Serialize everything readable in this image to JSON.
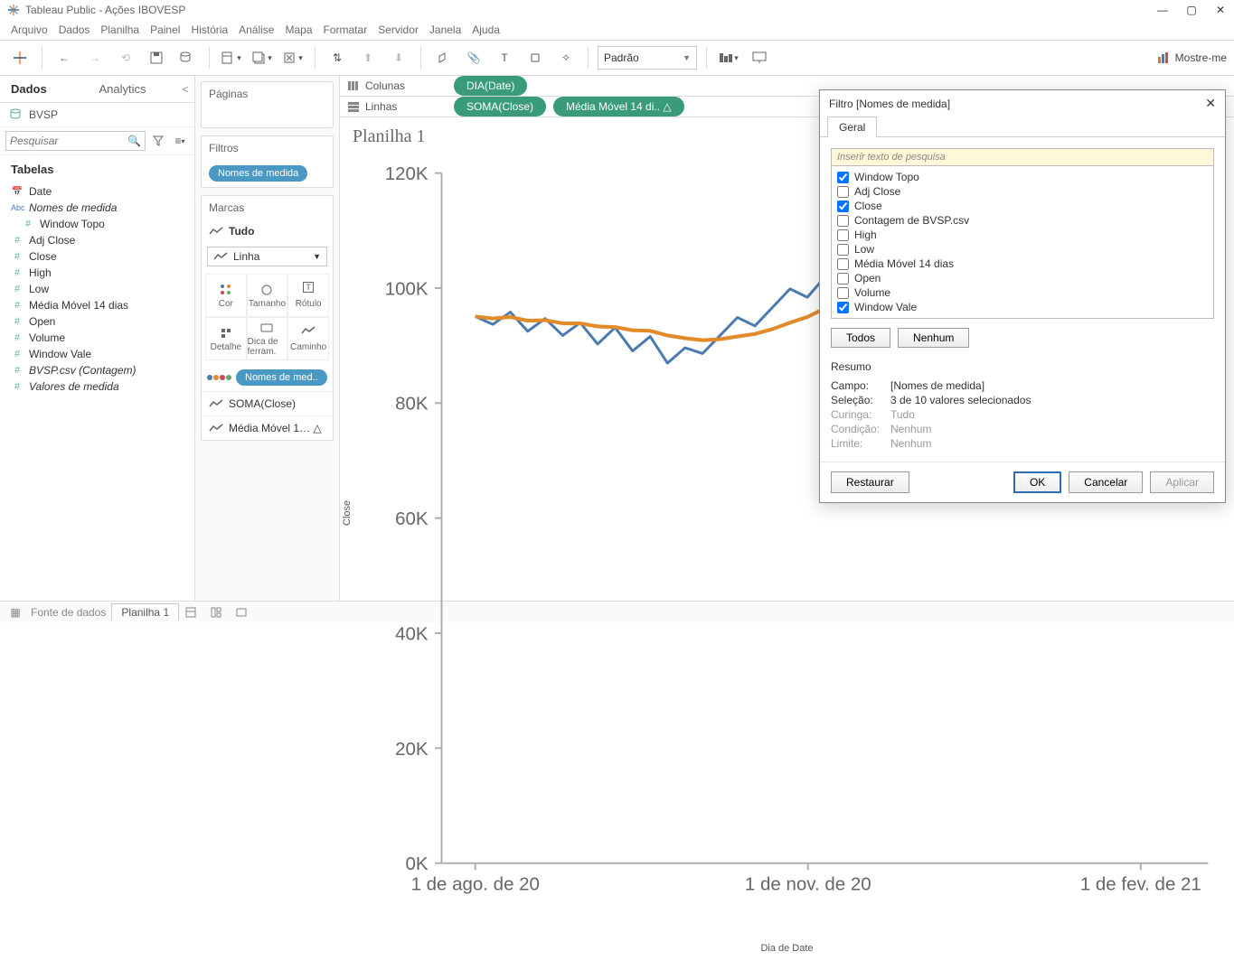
{
  "window": {
    "title": "Tableau Public - Ações IBOVESP"
  },
  "menu": [
    "Arquivo",
    "Dados",
    "Planilha",
    "Painel",
    "História",
    "Análise",
    "Mapa",
    "Formatar",
    "Servidor",
    "Janela",
    "Ajuda"
  ],
  "toolbar": {
    "fit_mode": "Padrão",
    "showme": "Mostre-me"
  },
  "datapane": {
    "tabs": {
      "data": "Dados",
      "analytics": "Analytics"
    },
    "datasource": "BVSP",
    "search_placeholder": "Pesquisar",
    "section": "Tabelas",
    "fields": [
      {
        "icon": "date",
        "label": "Date",
        "italic": false
      },
      {
        "icon": "abc",
        "label": "Nomes de medida",
        "italic": true
      },
      {
        "icon": "num",
        "label": "Window Topo",
        "italic": false,
        "indent": true
      },
      {
        "icon": "num",
        "label": "Adj Close",
        "italic": false
      },
      {
        "icon": "num",
        "label": "Close",
        "italic": false
      },
      {
        "icon": "num",
        "label": "High",
        "italic": false
      },
      {
        "icon": "num",
        "label": "Low",
        "italic": false
      },
      {
        "icon": "num",
        "label": "Média Móvel 14 dias",
        "italic": false
      },
      {
        "icon": "num",
        "label": "Open",
        "italic": false
      },
      {
        "icon": "num",
        "label": "Volume",
        "italic": false
      },
      {
        "icon": "num",
        "label": "Window Vale",
        "italic": false
      },
      {
        "icon": "num",
        "label": "BVSP.csv (Contagem)",
        "italic": true
      },
      {
        "icon": "num",
        "label": "Valores de medida",
        "italic": true
      }
    ]
  },
  "cards": {
    "pages": "Páginas",
    "filters": "Filtros",
    "filters_pill": "Nomes de medida",
    "marks": "Marcas",
    "marks_all": "Tudo",
    "marks_type": "Linha",
    "cells": [
      "Cor",
      "Tamanho",
      "Rótulo",
      "Detalhe",
      "Dica de ferram.",
      "Caminho"
    ],
    "marks_pill": "Nomes de med..",
    "measure_rows": [
      "SOMA(Close)",
      "Média Móvel 1…  △"
    ]
  },
  "shelves": {
    "columns_label": "Colunas",
    "rows_label": "Linhas",
    "columns": [
      "DIA(Date)"
    ],
    "rows": [
      "SOMA(Close)",
      "Média Móvel 14 di..  △"
    ]
  },
  "sheet": {
    "title": "Planilha 1",
    "y_axis": "Close",
    "x_axis": "Dia de Date"
  },
  "chart_data": {
    "type": "line",
    "xlabel": "Dia de Date",
    "ylabel": "Close",
    "ylim": [
      0,
      130000
    ],
    "y_ticks": [
      "0K",
      "20K",
      "40K",
      "60K",
      "80K",
      "100K",
      "120K"
    ],
    "x_ticks": [
      "1 de ago. de 20",
      "1 de nov. de 20",
      "1 de fev. de 21"
    ],
    "series": [
      {
        "name": "Close",
        "color": "#4a7ab0",
        "values": [
          103000,
          101500,
          103800,
          100200,
          102600,
          99400,
          101800,
          97800,
          100900,
          96500,
          99200,
          94200,
          97100,
          96000,
          99400,
          102800,
          101200,
          104700,
          108200,
          106600,
          110400,
          114800,
          112600,
          118400,
          116200,
          122200,
          119000,
          124800,
          117800,
          122800,
          116900,
          120600,
          114800,
          117600,
          112300,
          118200,
          115400,
          120800,
          119200,
          118600,
          121400
        ]
      },
      {
        "name": "Média Móvel 14 dias",
        "color": "#e28b2b",
        "values": [
          103000,
          102600,
          102900,
          102200,
          102300,
          101700,
          101700,
          101100,
          101000,
          100400,
          100300,
          99400,
          98900,
          98500,
          98700,
          99200,
          99700,
          100600,
          101800,
          102900,
          104500,
          106400,
          107900,
          109900,
          111500,
          113800,
          115100,
          117100,
          117600,
          118800,
          118800,
          119300,
          118900,
          118900,
          118300,
          118500,
          118300,
          118800,
          118900,
          118900,
          119300
        ]
      }
    ]
  },
  "dialog": {
    "title": "Filtro [Nomes de medida]",
    "tab": "Geral",
    "search_placeholder": "Inserir texto de pesquisa",
    "items": [
      {
        "label": "Window Topo",
        "checked": true
      },
      {
        "label": "Adj Close",
        "checked": false
      },
      {
        "label": "Close",
        "checked": true
      },
      {
        "label": "Contagem de BVSP.csv",
        "checked": false
      },
      {
        "label": "High",
        "checked": false
      },
      {
        "label": "Low",
        "checked": false
      },
      {
        "label": "Média Móvel 14 dias",
        "checked": false
      },
      {
        "label": "Open",
        "checked": false
      },
      {
        "label": "Volume",
        "checked": false
      },
      {
        "label": "Window Vale",
        "checked": true
      }
    ],
    "btn_all": "Todos",
    "btn_none": "Nenhum",
    "summary_title": "Resumo",
    "summary": [
      {
        "k": "Campo:",
        "v": "[Nomes de medida]",
        "dim": false
      },
      {
        "k": "Seleção:",
        "v": "3 de 10 valores selecionados",
        "dim": false
      },
      {
        "k": "Curinga:",
        "v": "Tudo",
        "dim": true
      },
      {
        "k": "Condição:",
        "v": "Nenhum",
        "dim": true
      },
      {
        "k": "Limite:",
        "v": "Nenhum",
        "dim": true
      }
    ],
    "btn_reset": "Restaurar",
    "btn_ok": "OK",
    "btn_cancel": "Cancelar",
    "btn_apply": "Aplicar"
  },
  "bottom": {
    "datasource_tab": "Fonte de dados",
    "sheet_tab": "Planilha 1"
  }
}
